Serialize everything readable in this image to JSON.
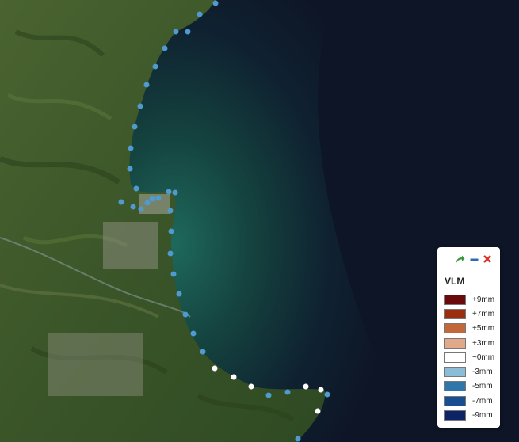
{
  "map": {
    "land_color": "#3f5a2c",
    "sea_color": "#0e1526",
    "coast_water_color": "#1b5a52",
    "station_points": [
      {
        "value_class": "-3mm"
      },
      {
        "value_class": "~0mm"
      }
    ]
  },
  "legend": {
    "title": "VLM",
    "controls": {
      "share_icon": "share-arrow-icon",
      "minimize_icon": "minimize-icon",
      "close_icon": "close-icon"
    },
    "items": [
      {
        "label": "+9mm",
        "color": "#6b0a0a"
      },
      {
        "label": "+7mm",
        "color": "#9a2e0e"
      },
      {
        "label": "+5mm",
        "color": "#c2683a"
      },
      {
        "label": "+3mm",
        "color": "#e2a88a"
      },
      {
        "label": "~0mm",
        "color": "#ffffff"
      },
      {
        "label": "-3mm",
        "color": "#8bbdd8"
      },
      {
        "label": "-5mm",
        "color": "#2f76ad"
      },
      {
        "label": "-7mm",
        "color": "#174f92"
      },
      {
        "label": "-9mm",
        "color": "#0c2366"
      }
    ]
  }
}
